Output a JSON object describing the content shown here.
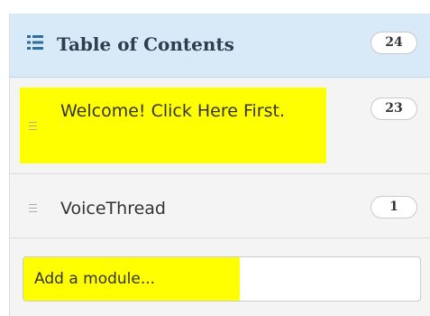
{
  "toc": {
    "title": "Table of Contents",
    "count": "24",
    "icon": "list-icon"
  },
  "modules": [
    {
      "title": "Welcome! Click Here First.",
      "count": "23",
      "highlighted": true
    },
    {
      "title": "VoiceThread",
      "count": "1",
      "highlighted": false
    }
  ],
  "add_module": {
    "placeholder": "Add a module..."
  },
  "colors": {
    "header_bg": "#d8e9f8",
    "highlight": "#ffff00",
    "panel_bg": "#f4f4f4"
  }
}
